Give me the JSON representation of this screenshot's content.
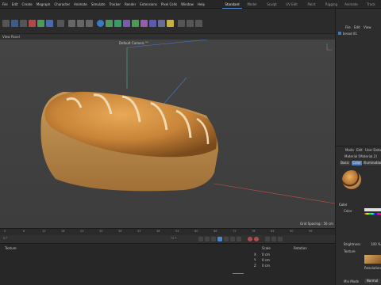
{
  "menubar": {
    "items": [
      "File",
      "Edit",
      "Create",
      "Mograph",
      "Character",
      "Animate",
      "Simulate",
      "Tracker",
      "Render",
      "Extensions",
      "Pixel Cells",
      "Window",
      "Help"
    ],
    "tabs": [
      "Standard",
      "Model",
      "Sculpt",
      "UV Edit",
      "Paint",
      "Rigging",
      "Animate",
      "Track"
    ],
    "active_tab": "Standard"
  },
  "viewport": {
    "menu": [
      "View",
      "Panel"
    ],
    "camera_label": "Default Camera °°",
    "grid_spacing": "Grid Spacing : 50 cm"
  },
  "object_manager": {
    "menu": [
      "File",
      "Edit",
      "View"
    ],
    "object_name": "bread 01"
  },
  "material": {
    "menu": [
      "Mode",
      "Edit",
      "User Data"
    ],
    "name": "Material [Material.2]",
    "tabs": [
      "Basic",
      "Color",
      "Illumination"
    ],
    "active_tab": "Color",
    "section": "Color",
    "color_label": "Color",
    "brightness_label": "Brightness",
    "brightness_value": "100 %",
    "texture_label": "Texture",
    "mix_mode_label": "Mix Mode",
    "mix_mode_value": "Normal",
    "resolution_label": "Resolution"
  },
  "timeline": {
    "ticks": [
      "0",
      "6",
      "12",
      "18",
      "24",
      "30",
      "36",
      "42",
      "48",
      "54",
      "60",
      "66",
      "72",
      "78",
      "84",
      "90",
      "96"
    ],
    "frame_current": "0 F",
    "frame_end": "72 F",
    "coords_headers": [
      "Scale",
      "Rotation"
    ],
    "coord_labels": [
      "X",
      "Y",
      "Z"
    ],
    "coord_values": [
      "0 cm",
      "0 cm",
      "0 cm"
    ],
    "bottom_tab": "Texture"
  },
  "colors": {
    "accent": "#4a86c8",
    "axis_y": "#4aa67a",
    "axis_x": "#c85050",
    "axis_z": "#4a78c8"
  }
}
